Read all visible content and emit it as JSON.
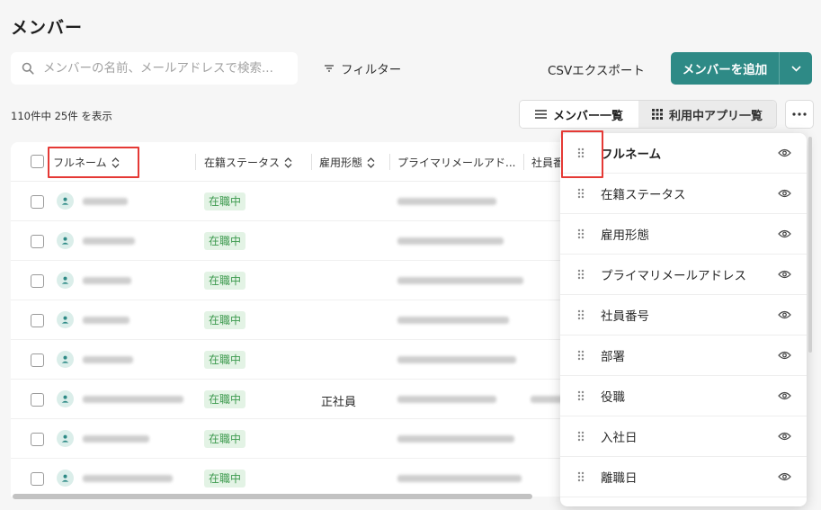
{
  "page": {
    "title": "メンバー"
  },
  "toolbar": {
    "search_placeholder": "メンバーの名前、メールアドレスで検索...",
    "filter_label": "フィルター",
    "csv_label": "CSVエクスポート",
    "add_label": "メンバーを追加"
  },
  "summary": {
    "count_text": "110件中 25件 を表示"
  },
  "view_toggle": {
    "member_list": "メンバー一覧",
    "apps_in_use": "利用中アプリ一覧",
    "active": "member_list"
  },
  "table": {
    "columns": [
      "フルネーム",
      "在籍ステータス",
      "雇用形態",
      "プライマリメールアド...",
      "社員番"
    ],
    "rows": [
      {
        "status": "在職中",
        "employment": ""
      },
      {
        "status": "在職中",
        "employment": ""
      },
      {
        "status": "在職中",
        "employment": ""
      },
      {
        "status": "在職中",
        "employment": ""
      },
      {
        "status": "在職中",
        "employment": ""
      },
      {
        "status": "在職中",
        "employment": "正社員"
      },
      {
        "status": "在職中",
        "employment": ""
      },
      {
        "status": "在職中",
        "employment": ""
      }
    ]
  },
  "column_panel": {
    "items": [
      "フルネーム",
      "在籍ステータス",
      "雇用形態",
      "プライマリメールアドレス",
      "社員番号",
      "部署",
      "役職",
      "入社日",
      "離職日"
    ]
  },
  "colors": {
    "accent": "#2e8a86",
    "badge_bg": "#e3f3e5",
    "badge_text": "#3d9a4e",
    "highlight": "#e53935"
  },
  "icons": {
    "search": "search-icon",
    "filter": "filter-icon",
    "chevron": "chevron-down-icon",
    "sort": "sort-icon",
    "grip": "drag-handle-icon",
    "eye": "eye-icon",
    "list": "list-icon",
    "grid": "grid-icon",
    "more": "more-icon",
    "user": "user-icon"
  }
}
